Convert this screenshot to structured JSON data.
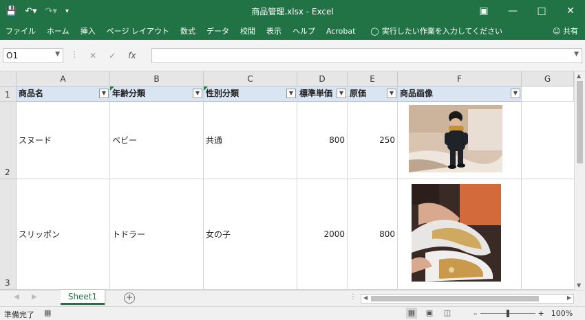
{
  "window": {
    "title": "商品管理.xlsx  -  Excel",
    "controls": [
      "restore-ribbon",
      "minimize",
      "maximize",
      "close"
    ]
  },
  "ribbon": {
    "tabs": [
      "ファイル",
      "ホーム",
      "挿入",
      "ページ レイアウト",
      "数式",
      "データ",
      "校閲",
      "表示",
      "ヘルプ",
      "Acrobat"
    ],
    "tell_me": "実行したい作業を入力してください",
    "share": "共有"
  },
  "formula_bar": {
    "name_box": "O1",
    "fx": "fx",
    "value": ""
  },
  "columns": [
    "A",
    "B",
    "C",
    "D",
    "E",
    "F",
    "G"
  ],
  "rows": [
    "1",
    "2",
    "3"
  ],
  "headers": [
    "商品名",
    "年齢分類",
    "性別分類",
    "標準単価",
    "原価",
    "商品画像"
  ],
  "data_rows": [
    {
      "name": "スヌード",
      "age": "ベビー",
      "gender": "共通",
      "price": "800",
      "cost": "250",
      "image": "toddler-in-snood-photo"
    },
    {
      "name": "スリッポン",
      "age": "トドラー",
      "gender": "女の子",
      "price": "2000",
      "cost": "800",
      "image": "slip-on-shoes-photo"
    }
  ],
  "sheets": [
    "Sheet1"
  ],
  "status": {
    "ready": "準備完了",
    "zoom": "100%"
  },
  "colors": {
    "excel_green": "#217346",
    "header_fill": "#dae5f3"
  }
}
